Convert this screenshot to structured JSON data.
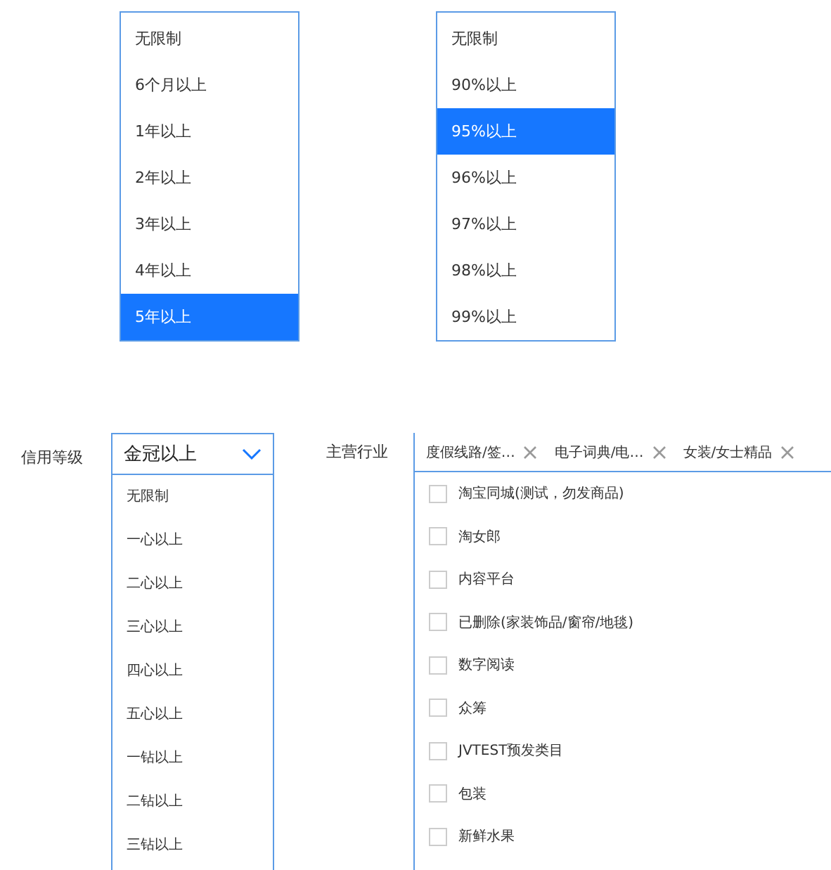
{
  "top_lists": [
    {
      "options": [
        {
          "label": "无限制",
          "selected": false
        },
        {
          "label": "6个月以上",
          "selected": false
        },
        {
          "label": "1年以上",
          "selected": false
        },
        {
          "label": "2年以上",
          "selected": false
        },
        {
          "label": "3年以上",
          "selected": false
        },
        {
          "label": "4年以上",
          "selected": false
        },
        {
          "label": "5年以上",
          "selected": true
        }
      ]
    },
    {
      "options": [
        {
          "label": "无限制",
          "selected": false
        },
        {
          "label": "90%以上",
          "selected": false
        },
        {
          "label": "95%以上",
          "selected": true
        },
        {
          "label": "96%以上",
          "selected": false
        },
        {
          "label": "97%以上",
          "selected": false
        },
        {
          "label": "98%以上",
          "selected": false
        },
        {
          "label": "99%以上",
          "selected": false
        }
      ]
    }
  ],
  "credit": {
    "label": "信用等级",
    "value": "金冠以上",
    "options": [
      {
        "label": "无限制",
        "selected": false
      },
      {
        "label": "一心以上",
        "selected": false
      },
      {
        "label": "二心以上",
        "selected": false
      },
      {
        "label": "三心以上",
        "selected": false
      },
      {
        "label": "四心以上",
        "selected": false
      },
      {
        "label": "五心以上",
        "selected": false
      },
      {
        "label": "一钻以上",
        "selected": false
      },
      {
        "label": "二钻以上",
        "selected": false
      },
      {
        "label": "三钻以上",
        "selected": false
      }
    ]
  },
  "industry": {
    "label": "主营行业",
    "tags": [
      "度假线路/签…",
      "电子词典/电…",
      "女装/女士精品"
    ],
    "options": [
      {
        "label": "淘宝同城(测试，勿发商品)",
        "checked": false
      },
      {
        "label": "淘女郎",
        "checked": false
      },
      {
        "label": "内容平台",
        "checked": false
      },
      {
        "label": "已删除(家装饰品/窗帘/地毯)",
        "checked": false
      },
      {
        "label": "数字阅读",
        "checked": false
      },
      {
        "label": "众筹",
        "checked": false
      },
      {
        "label": "JVTEST预发类目",
        "checked": false
      },
      {
        "label": "包装",
        "checked": false
      },
      {
        "label": "新鲜水果",
        "checked": false
      }
    ]
  }
}
